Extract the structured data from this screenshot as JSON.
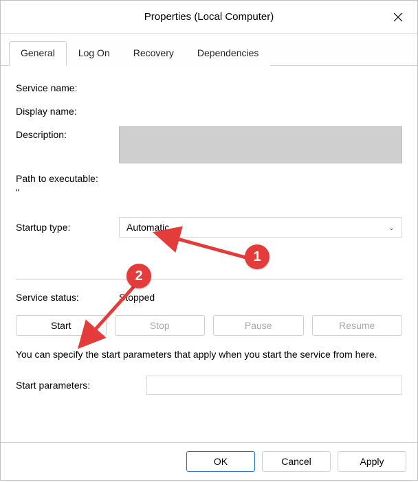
{
  "title": "Properties (Local Computer)",
  "tabs": {
    "general": "General",
    "logon": "Log On",
    "recovery": "Recovery",
    "dependencies": "Dependencies"
  },
  "labels": {
    "service_name": "Service name:",
    "display_name": "Display name:",
    "description": "Description:",
    "path_to_executable": "Path to executable:",
    "startup_type": "Startup type:",
    "service_status": "Service status:",
    "start_parameters": "Start parameters:"
  },
  "values": {
    "service_name": "",
    "display_name": "",
    "description": "",
    "path": "\"",
    "startup_type_selected": "Automatic",
    "service_status": "Stopped",
    "start_parameters": ""
  },
  "buttons": {
    "start": "Start",
    "stop": "Stop",
    "pause": "Pause",
    "resume": "Resume",
    "ok": "OK",
    "cancel": "Cancel",
    "apply": "Apply"
  },
  "info_text": "You can specify the start parameters that apply when you start the service from here.",
  "annotations": {
    "badge1": "1",
    "badge2": "2"
  }
}
